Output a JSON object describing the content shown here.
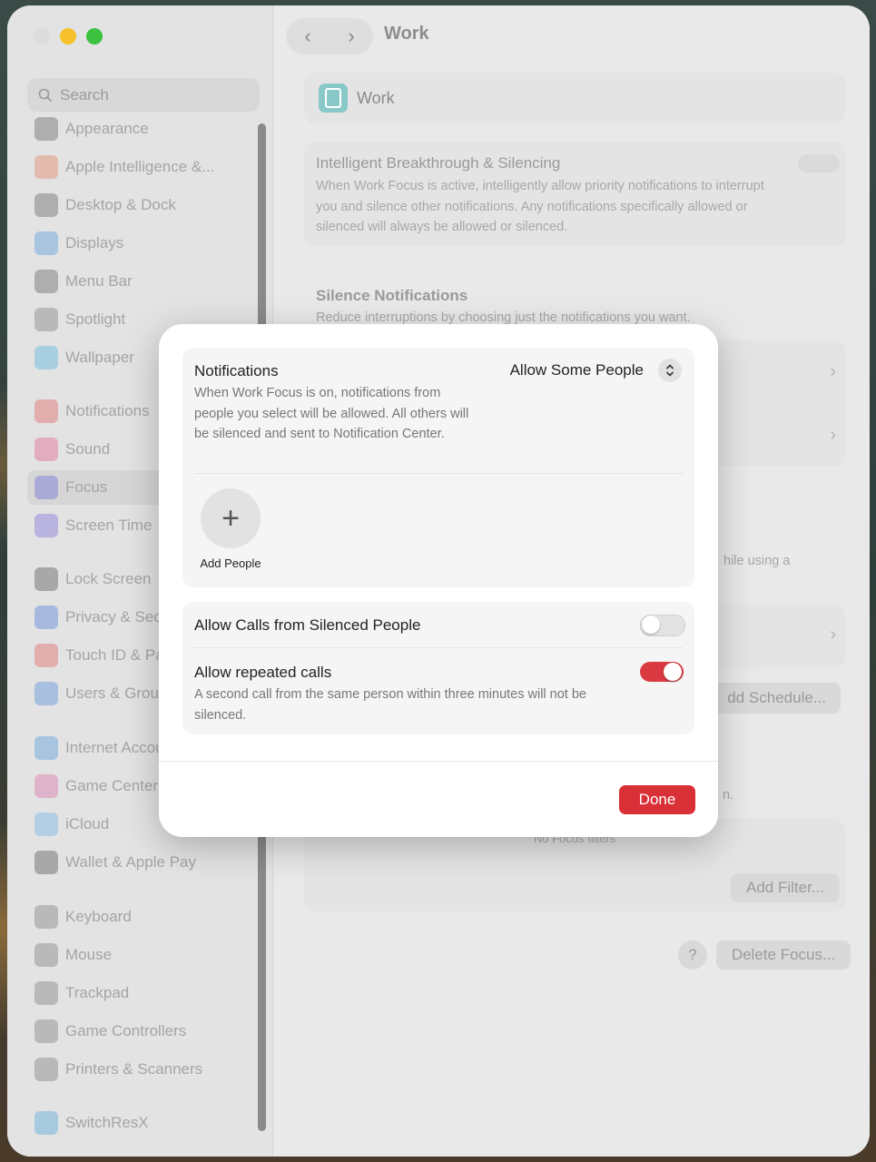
{
  "window": {
    "title": "Work"
  },
  "sidebar": {
    "search_placeholder": "Search",
    "items": [
      {
        "label": "Appearance",
        "icon": "appearance-icon",
        "color": "#4a4a4a"
      },
      {
        "label": "Apple Intelligence &...",
        "icon": "apple-intelligence-icon",
        "color": "#e0704a"
      },
      {
        "label": "Desktop & Dock",
        "icon": "desktop-dock-icon",
        "color": "#4a4a4a"
      },
      {
        "label": "Displays",
        "icon": "displays-icon",
        "color": "#3a8ad8"
      },
      {
        "label": "Menu Bar",
        "icon": "menu-bar-icon",
        "color": "#4a4a4a"
      },
      {
        "label": "Spotlight",
        "icon": "spotlight-icon",
        "color": "#6a6a6a"
      },
      {
        "label": "Wallpaper",
        "icon": "wallpaper-icon",
        "color": "#3aa8d8"
      },
      {
        "label": "Notifications",
        "icon": "notifications-icon",
        "color": "#e04848"
      },
      {
        "label": "Sound",
        "icon": "sound-icon",
        "color": "#e04878"
      },
      {
        "label": "Focus",
        "icon": "focus-icon",
        "color": "#5a5ad8"
      },
      {
        "label": "Screen Time",
        "icon": "screen-time-icon",
        "color": "#6a5ad8"
      },
      {
        "label": "Lock Screen",
        "icon": "lock-screen-icon",
        "color": "#3a3a3a"
      },
      {
        "label": "Privacy & Security",
        "icon": "privacy-icon",
        "color": "#3a6ad8"
      },
      {
        "label": "Touch ID & Password",
        "icon": "touch-id-icon",
        "color": "#e04848"
      },
      {
        "label": "Users & Groups",
        "icon": "users-groups-icon",
        "color": "#3a7ad8"
      },
      {
        "label": "Internet Accounts",
        "icon": "internet-accounts-icon",
        "color": "#3a8ad8"
      },
      {
        "label": "Game Center",
        "icon": "game-center-icon",
        "color": "#d85a9a"
      },
      {
        "label": "iCloud",
        "icon": "icloud-icon",
        "color": "#5aa8e8"
      },
      {
        "label": "Wallet & Apple Pay",
        "icon": "wallet-icon",
        "color": "#3a3a3a"
      },
      {
        "label": "Keyboard",
        "icon": "keyboard-icon",
        "color": "#6a6a6a"
      },
      {
        "label": "Mouse",
        "icon": "mouse-icon",
        "color": "#6a6a6a"
      },
      {
        "label": "Trackpad",
        "icon": "trackpad-icon",
        "color": "#6a6a6a"
      },
      {
        "label": "Game Controllers",
        "icon": "game-controllers-icon",
        "color": "#6a6a6a"
      },
      {
        "label": "Printers & Scanners",
        "icon": "printers-icon",
        "color": "#6a6a6a"
      },
      {
        "label": "SwitchResX",
        "icon": "switchresx-icon",
        "color": "#3a9ad8"
      }
    ]
  },
  "main": {
    "header_label": "Work",
    "breakthrough_title": "Intelligent Breakthrough & Silencing",
    "breakthrough_desc": "When Work Focus is active, intelligently allow priority notifications to interrupt you and silence other notifications. Any notifications specifically allowed or silenced will always be allowed or silenced.",
    "silence_title": "Silence Notifications",
    "silence_desc": "Reduce interruptions by choosing just the notifications you want.",
    "partial_text_while": "hile using a",
    "add_schedule": "dd Schedule...",
    "partial_text_n": "n.",
    "no_filters": "No Focus filters",
    "add_filter": "Add Filter...",
    "help": "?",
    "delete_focus": "Delete Focus..."
  },
  "modal": {
    "notifications_title": "Notifications",
    "notifications_value": "Allow Some People",
    "notifications_desc": "When Work Focus is on, notifications from people you select will be allowed. All others will be silenced and sent to Notification Center.",
    "add_people_label": "Add People",
    "allow_calls_label": "Allow Calls from Silenced People",
    "allow_calls_on": false,
    "repeated_calls_label": "Allow repeated calls",
    "repeated_calls_desc": "A second call from the same person within three minutes will not be silenced.",
    "repeated_calls_on": true,
    "done_label": "Done",
    "accent": "#d92f36"
  }
}
